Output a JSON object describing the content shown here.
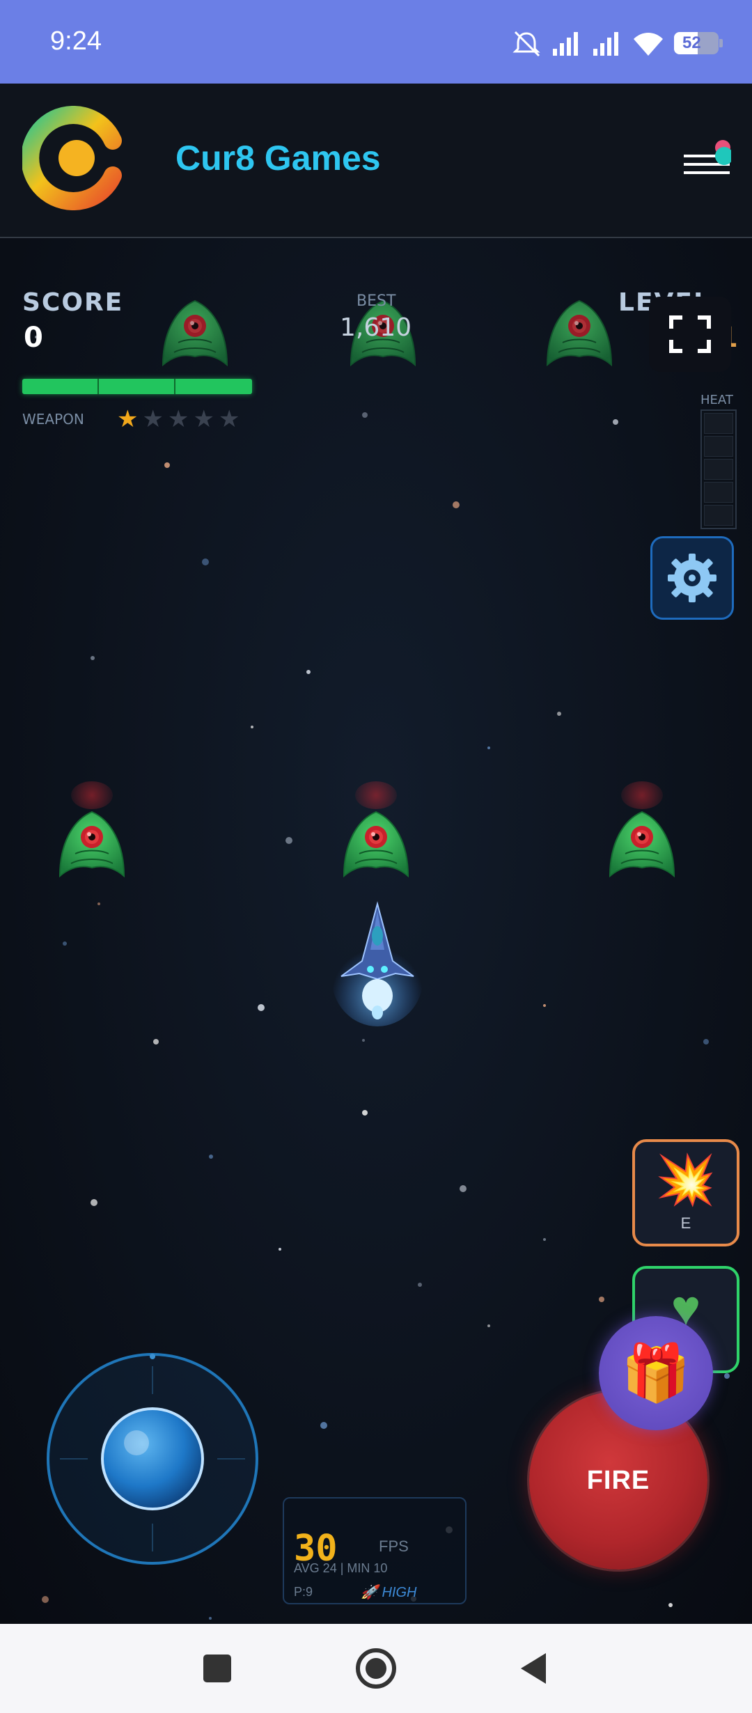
{
  "status_bar": {
    "time": "9:24",
    "battery": "52",
    "icons": [
      "mute-icon",
      "signal-icon",
      "signal-icon",
      "wifi-icon",
      "battery-icon"
    ]
  },
  "header": {
    "title": "Cur8 Games",
    "logo_icon": "cur8-logo-icon",
    "menu_icon": "hamburger-menu-icon"
  },
  "hud": {
    "score_label": "SCORE",
    "score_value": "0",
    "best_label": "BEST",
    "best_value": "1,610",
    "level_label": "LEVEL",
    "level_value": "1",
    "weapon_label": "WEAPON",
    "weapon_stars_filled": 1,
    "weapon_stars_total": 5,
    "heat_label": "HEAT",
    "heat_level": 0,
    "health_fraction": 1.0
  },
  "controls": {
    "fire_label": "FIRE",
    "bomb_key": "E",
    "bomb_icon": "explosion-icon",
    "heart_icon": "heart-icon",
    "gift_icon": "gift-icon",
    "fullscreen_icon": "fullscreen-icon",
    "settings_icon": "gear-icon"
  },
  "fps": {
    "value": "30",
    "label": "FPS",
    "stats": "AVG 24 | MIN 10",
    "particles": "P:9",
    "quality": "🚀 HIGH"
  },
  "colors": {
    "status_bar": "#6b7fe6",
    "title": "#2ec6f0",
    "fire": "#b0262b",
    "health": "#22c55e",
    "accent_gold": "#f2b21b"
  }
}
